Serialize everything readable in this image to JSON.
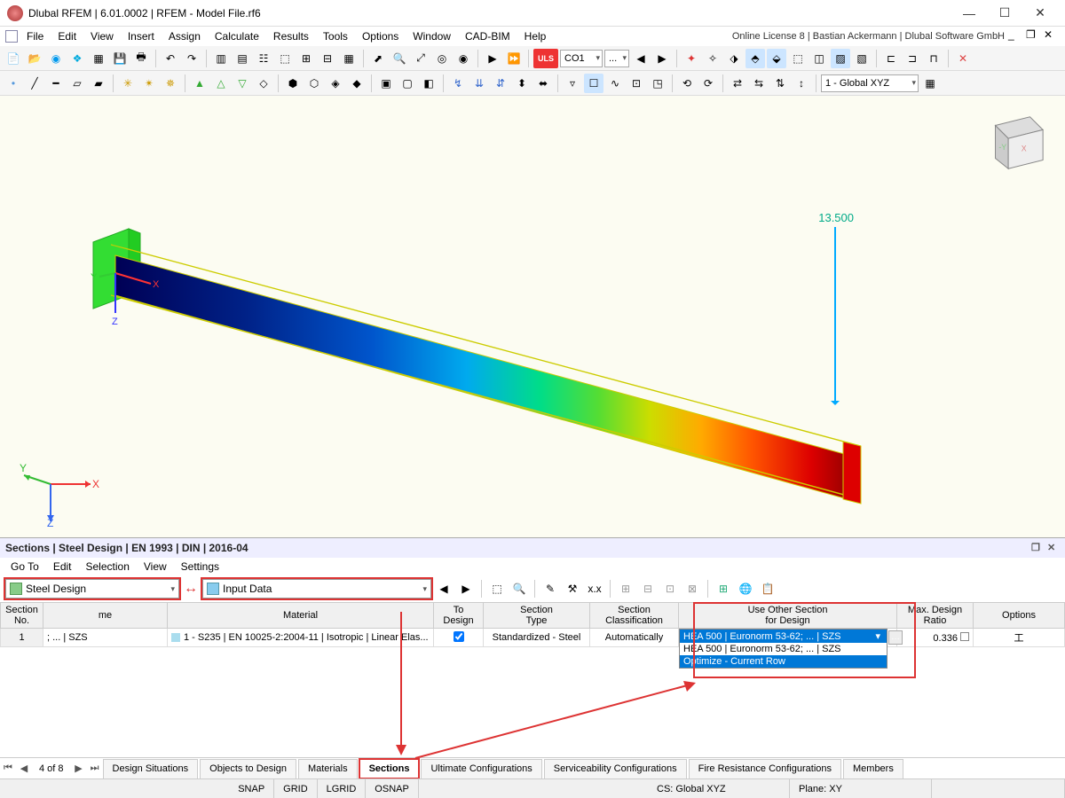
{
  "titlebar": {
    "title": "Dlubal RFEM | 6.01.0002 | RFEM - Model File.rf6"
  },
  "menus": [
    "File",
    "Edit",
    "View",
    "Insert",
    "Assign",
    "Calculate",
    "Results",
    "Tools",
    "Options",
    "Window",
    "CAD-BIM",
    "Help"
  ],
  "license_text": "Online License 8 | Bastian Ackermann | Dlubal Software GmbH",
  "tb1": {
    "uls": "ULS",
    "co1": "CO1",
    "dots": "...",
    "global": "1 - Global XYZ"
  },
  "viewport": {
    "annotation_value": "13.500",
    "axis_x": "X",
    "axis_y": "Y",
    "axis_z": "Z",
    "triad_x": "X",
    "triad_y": "Y",
    "triad_z": "Z"
  },
  "bottom": {
    "title": "Sections | Steel Design | EN 1993 | DIN | 2016-04",
    "menus": [
      "Go To",
      "Edit",
      "Selection",
      "View",
      "Settings"
    ],
    "dd_module": "Steel Design",
    "dd_input": "Input Data",
    "headers": {
      "no": "Section\nNo.",
      "name": "me",
      "material": "Material",
      "todesign": "To\nDesign",
      "sectype": "Section\nType",
      "secclass": "Section\nClassification",
      "useother": "Use Other Section\nfor Design",
      "maxratio": "Max. Design\nRatio",
      "options": "Options"
    },
    "row": {
      "no": "1",
      "name": "; ... | SZS",
      "material": "1 - S235 | EN 10025-2:2004-11 | Isotropic | Linear Elas...",
      "sectype": "Standardized - Steel",
      "secclass": "Automatically",
      "ratio": "0.336"
    },
    "dropdown": {
      "selected": "HEA 500 | Euronorm 53-62; ... | SZS",
      "opt1": "HEA 500 | Euronorm 53-62; ... | SZS",
      "opt2": "Optimize - Current Row"
    },
    "tabs": [
      "Design Situations",
      "Objects to Design",
      "Materials",
      "Sections",
      "Ultimate Configurations",
      "Serviceability Configurations",
      "Fire Resistance Configurations",
      "Members"
    ],
    "page": "4 of 8"
  },
  "status": {
    "snap": "SNAP",
    "grid": "GRID",
    "lgrid": "LGRID",
    "osnap": "OSNAP",
    "cs": "CS: Global XYZ",
    "plane": "Plane: XY"
  }
}
